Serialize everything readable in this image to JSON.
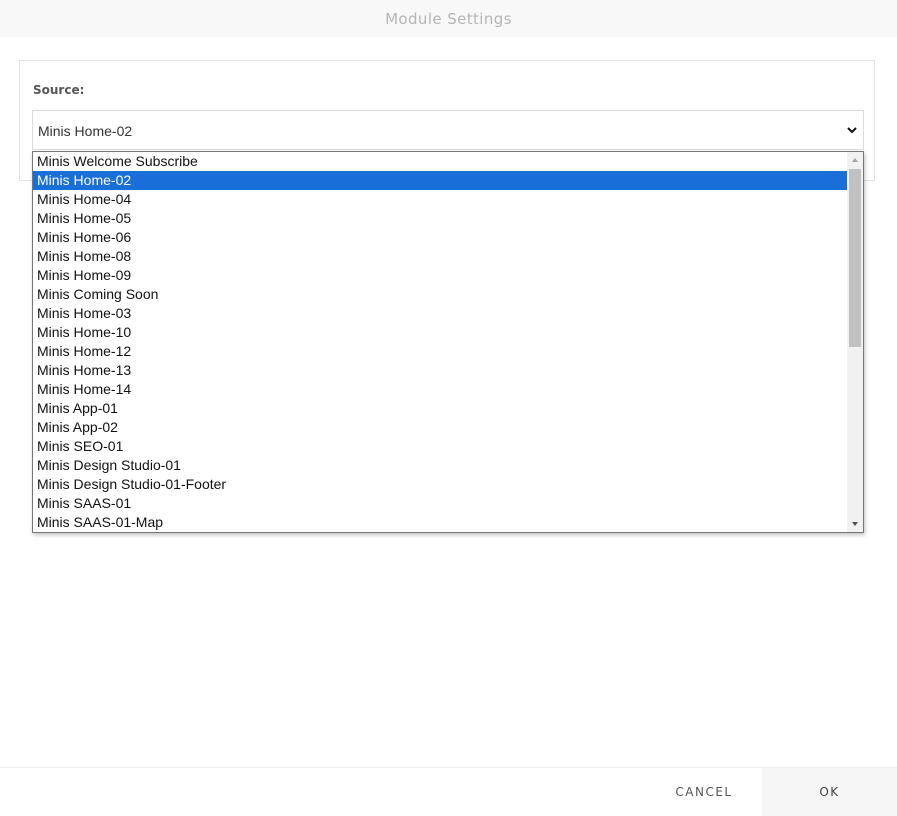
{
  "header": {
    "title": "Module Settings"
  },
  "source": {
    "label": "Source:",
    "selected": "Minis Home-02",
    "options": [
      "Minis Welcome Subscribe",
      "Minis Home-02",
      "Minis Home-04",
      "Minis Home-05",
      "Minis Home-06",
      "Minis Home-08",
      "Minis Home-09",
      "Minis Coming Soon",
      "Minis Home-03",
      "Minis Home-10",
      "Minis Home-12",
      "Minis Home-13",
      "Minis Home-14",
      "Minis App-01",
      "Minis App-02",
      "Minis SEO-01",
      "Minis Design Studio-01",
      "Minis Design Studio-01-Footer",
      "Minis SAAS-01",
      "Minis SAAS-01-Map"
    ],
    "selected_index": 1
  },
  "footer": {
    "cancel_label": "CANCEL",
    "ok_label": "OK"
  },
  "colors": {
    "highlight": "#1a6ed8",
    "header_bg": "#f8f8f8",
    "ok_bg": "#f5f5f5"
  },
  "icons": {
    "select_arrow": "chevron-down-icon",
    "scroll_up": "triangle-up-icon",
    "scroll_down": "triangle-down-icon"
  }
}
